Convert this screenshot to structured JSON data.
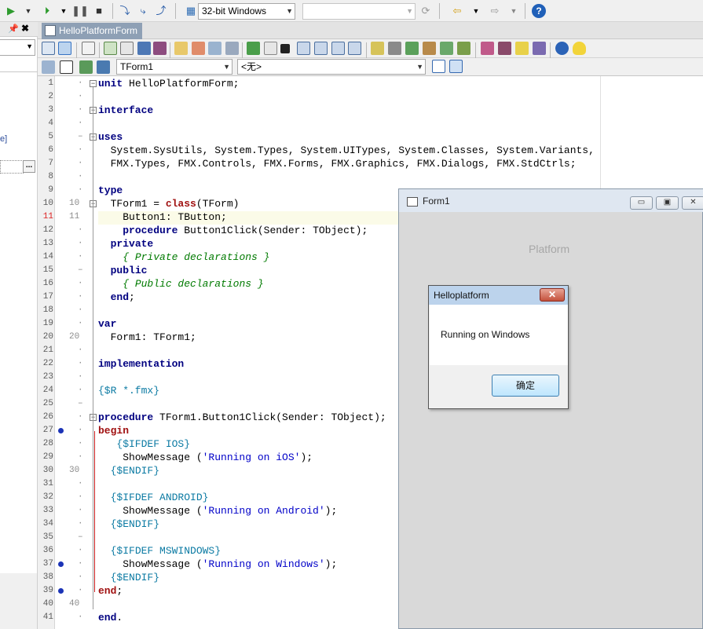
{
  "toolbar_top": {
    "platform_select": "32-bit Windows",
    "search_value": ""
  },
  "left_pane": {
    "fragment_text": "e]",
    "ellipsis_label": "..."
  },
  "editor_tab": {
    "label": "HelloPlatformForm"
  },
  "class_bar": {
    "class_select": "TForm1",
    "member_select": "<无>"
  },
  "editor": {
    "line_numbers": [
      "1",
      "2",
      "3",
      "4",
      "5",
      "6",
      "7",
      "8",
      "9",
      "10",
      "11",
      "12",
      "13",
      "14",
      "15",
      "16",
      "17",
      "18",
      "19",
      "20",
      "21",
      "22",
      "23",
      "24",
      "25",
      "26",
      "27",
      "28",
      "29",
      "30",
      "31",
      "32",
      "33",
      "34",
      "35",
      "36",
      "37",
      "38",
      "39",
      "40",
      "41"
    ],
    "current_line": "11",
    "gutter_marks": {
      "10": "10",
      "11": "11",
      "20": "20",
      "30": "30",
      "40": "40"
    },
    "breakpoint_lines": [
      "27",
      "37",
      "39"
    ]
  },
  "form_window": {
    "title": "Form1",
    "platform_label": "Platform",
    "min_glyph": "▭",
    "max_glyph": "▣",
    "close_glyph": "✕"
  },
  "dialog": {
    "title": "Helloplatform",
    "message": "Running on Windows",
    "ok_label": "确定",
    "close_glyph": "✕"
  }
}
